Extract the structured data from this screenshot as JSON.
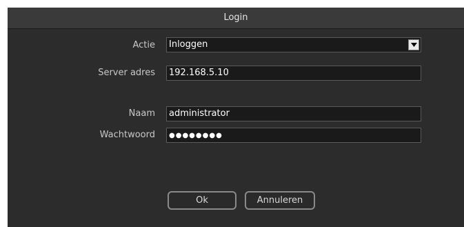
{
  "dialog": {
    "title": "Login"
  },
  "form": {
    "action": {
      "label": "Actie",
      "value": "Inloggen"
    },
    "server": {
      "label": "Server adres",
      "value": "192.168.5.10"
    },
    "name": {
      "label": "Naam",
      "value": "administrator"
    },
    "password": {
      "label": "Wachtwoord",
      "masked_value": "●●●●●●●●"
    }
  },
  "buttons": {
    "ok_label": "Ok",
    "cancel_label": "Annuleren"
  },
  "icons": {
    "select_arrow": "chevron-down-icon"
  }
}
